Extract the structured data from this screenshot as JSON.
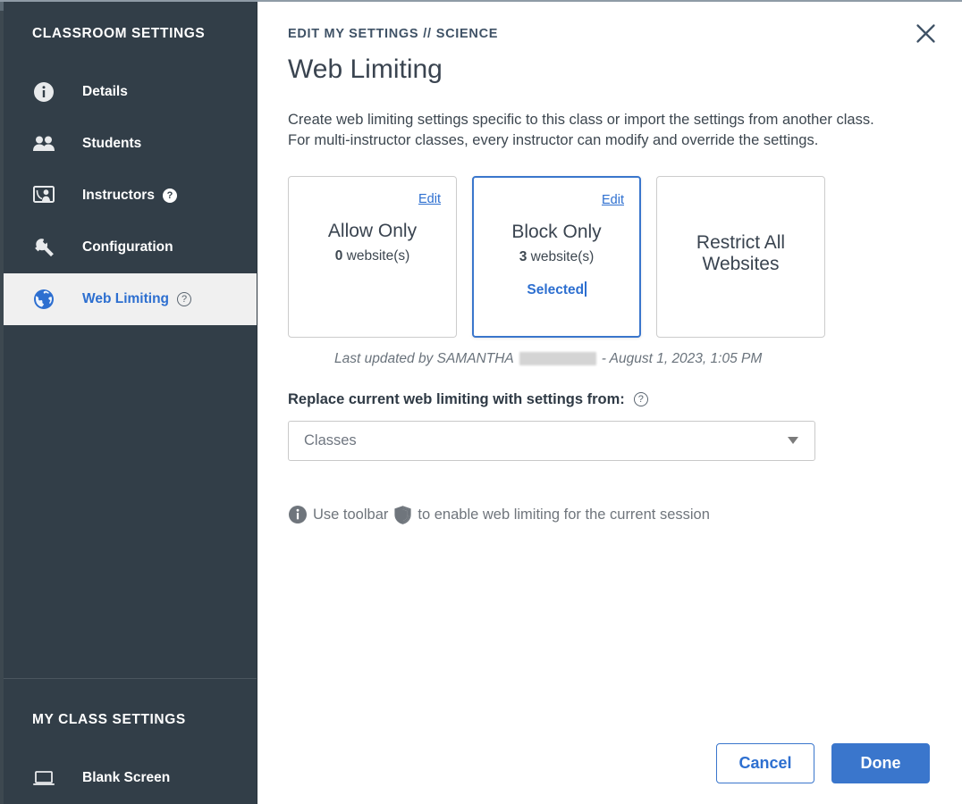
{
  "sidebar": {
    "top_section_title": "CLASSROOM SETTINGS",
    "items": [
      {
        "label": "Details",
        "icon": "info-circle-icon",
        "active": false,
        "help": ""
      },
      {
        "label": "Students",
        "icon": "people-icon",
        "active": false,
        "help": ""
      },
      {
        "label": "Instructors",
        "icon": "instructor-board-icon",
        "active": false,
        "help": "?"
      },
      {
        "label": "Configuration",
        "icon": "wrench-icon",
        "active": false,
        "help": ""
      },
      {
        "label": "Web Limiting",
        "icon": "globe-icon",
        "active": true,
        "help": "?"
      }
    ],
    "bottom_section_title": "MY CLASS SETTINGS",
    "bottom_items": [
      {
        "label": "Blank Screen",
        "icon": "laptop-icon"
      }
    ]
  },
  "header": {
    "breadcrumb_root": "EDIT MY SETTINGS",
    "breadcrumb_separator": "//",
    "breadcrumb_current": "SCIENCE",
    "page_title": "Web Limiting",
    "close_icon": "close-icon"
  },
  "main": {
    "description_line1": "Create web limiting settings specific to this class or import the settings from another class.",
    "description_line2": "For multi-instructor classes, every instructor can modify and override the settings.",
    "cards": [
      {
        "name": "Allow Only",
        "count": "0",
        "count_suffix": " website(s)",
        "edit_label": "Edit",
        "has_edit": true,
        "selected": false,
        "selected_label": ""
      },
      {
        "name": "Block Only",
        "count": "3",
        "count_suffix": " website(s)",
        "edit_label": "Edit",
        "has_edit": true,
        "selected": true,
        "selected_label": "Selected"
      },
      {
        "name": "Restrict All Websites",
        "count": "",
        "count_suffix": "",
        "edit_label": "",
        "has_edit": false,
        "selected": false,
        "selected_label": ""
      }
    ],
    "last_updated_prefix": "Last updated by SAMANTHA",
    "last_updated_redacted": true,
    "last_updated_suffix": "- August 1, 2023, 1:05 PM",
    "replace_label": "Replace current web limiting with settings from:",
    "replace_help": "?",
    "select_placeholder": "Classes",
    "select_value": "Classes",
    "hint_prefix": "Use toolbar",
    "hint_suffix": "to enable web limiting for the current session",
    "hint_info_icon": "info-circle-icon",
    "hint_shield_icon": "shield-icon"
  },
  "footer": {
    "cancel_label": "Cancel",
    "done_label": "Done"
  },
  "colors": {
    "sidebar_bg": "#323e48",
    "accent_blue": "#2d6fd0",
    "border_blue": "#3a76cc",
    "active_item_bg": "#f0f0f0",
    "title_gray": "#3a4450",
    "muted_gray": "#6f757c"
  }
}
